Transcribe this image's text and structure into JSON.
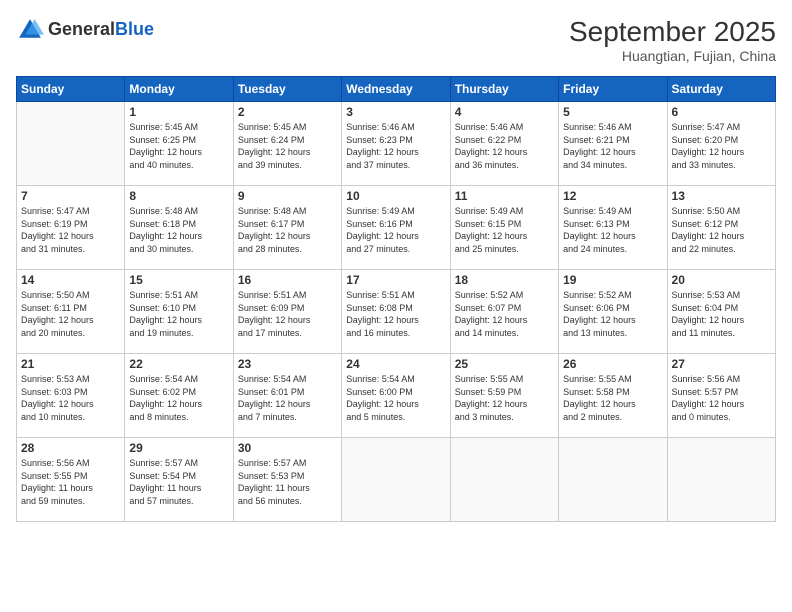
{
  "header": {
    "logo_general": "General",
    "logo_blue": "Blue",
    "month": "September 2025",
    "location": "Huangtian, Fujian, China"
  },
  "days_of_week": [
    "Sunday",
    "Monday",
    "Tuesday",
    "Wednesday",
    "Thursday",
    "Friday",
    "Saturday"
  ],
  "weeks": [
    [
      {
        "day": "",
        "info": ""
      },
      {
        "day": "1",
        "info": "Sunrise: 5:45 AM\nSunset: 6:25 PM\nDaylight: 12 hours\nand 40 minutes."
      },
      {
        "day": "2",
        "info": "Sunrise: 5:45 AM\nSunset: 6:24 PM\nDaylight: 12 hours\nand 39 minutes."
      },
      {
        "day": "3",
        "info": "Sunrise: 5:46 AM\nSunset: 6:23 PM\nDaylight: 12 hours\nand 37 minutes."
      },
      {
        "day": "4",
        "info": "Sunrise: 5:46 AM\nSunset: 6:22 PM\nDaylight: 12 hours\nand 36 minutes."
      },
      {
        "day": "5",
        "info": "Sunrise: 5:46 AM\nSunset: 6:21 PM\nDaylight: 12 hours\nand 34 minutes."
      },
      {
        "day": "6",
        "info": "Sunrise: 5:47 AM\nSunset: 6:20 PM\nDaylight: 12 hours\nand 33 minutes."
      }
    ],
    [
      {
        "day": "7",
        "info": "Sunrise: 5:47 AM\nSunset: 6:19 PM\nDaylight: 12 hours\nand 31 minutes."
      },
      {
        "day": "8",
        "info": "Sunrise: 5:48 AM\nSunset: 6:18 PM\nDaylight: 12 hours\nand 30 minutes."
      },
      {
        "day": "9",
        "info": "Sunrise: 5:48 AM\nSunset: 6:17 PM\nDaylight: 12 hours\nand 28 minutes."
      },
      {
        "day": "10",
        "info": "Sunrise: 5:49 AM\nSunset: 6:16 PM\nDaylight: 12 hours\nand 27 minutes."
      },
      {
        "day": "11",
        "info": "Sunrise: 5:49 AM\nSunset: 6:15 PM\nDaylight: 12 hours\nand 25 minutes."
      },
      {
        "day": "12",
        "info": "Sunrise: 5:49 AM\nSunset: 6:13 PM\nDaylight: 12 hours\nand 24 minutes."
      },
      {
        "day": "13",
        "info": "Sunrise: 5:50 AM\nSunset: 6:12 PM\nDaylight: 12 hours\nand 22 minutes."
      }
    ],
    [
      {
        "day": "14",
        "info": "Sunrise: 5:50 AM\nSunset: 6:11 PM\nDaylight: 12 hours\nand 20 minutes."
      },
      {
        "day": "15",
        "info": "Sunrise: 5:51 AM\nSunset: 6:10 PM\nDaylight: 12 hours\nand 19 minutes."
      },
      {
        "day": "16",
        "info": "Sunrise: 5:51 AM\nSunset: 6:09 PM\nDaylight: 12 hours\nand 17 minutes."
      },
      {
        "day": "17",
        "info": "Sunrise: 5:51 AM\nSunset: 6:08 PM\nDaylight: 12 hours\nand 16 minutes."
      },
      {
        "day": "18",
        "info": "Sunrise: 5:52 AM\nSunset: 6:07 PM\nDaylight: 12 hours\nand 14 minutes."
      },
      {
        "day": "19",
        "info": "Sunrise: 5:52 AM\nSunset: 6:06 PM\nDaylight: 12 hours\nand 13 minutes."
      },
      {
        "day": "20",
        "info": "Sunrise: 5:53 AM\nSunset: 6:04 PM\nDaylight: 12 hours\nand 11 minutes."
      }
    ],
    [
      {
        "day": "21",
        "info": "Sunrise: 5:53 AM\nSunset: 6:03 PM\nDaylight: 12 hours\nand 10 minutes."
      },
      {
        "day": "22",
        "info": "Sunrise: 5:54 AM\nSunset: 6:02 PM\nDaylight: 12 hours\nand 8 minutes."
      },
      {
        "day": "23",
        "info": "Sunrise: 5:54 AM\nSunset: 6:01 PM\nDaylight: 12 hours\nand 7 minutes."
      },
      {
        "day": "24",
        "info": "Sunrise: 5:54 AM\nSunset: 6:00 PM\nDaylight: 12 hours\nand 5 minutes."
      },
      {
        "day": "25",
        "info": "Sunrise: 5:55 AM\nSunset: 5:59 PM\nDaylight: 12 hours\nand 3 minutes."
      },
      {
        "day": "26",
        "info": "Sunrise: 5:55 AM\nSunset: 5:58 PM\nDaylight: 12 hours\nand 2 minutes."
      },
      {
        "day": "27",
        "info": "Sunrise: 5:56 AM\nSunset: 5:57 PM\nDaylight: 12 hours\nand 0 minutes."
      }
    ],
    [
      {
        "day": "28",
        "info": "Sunrise: 5:56 AM\nSunset: 5:55 PM\nDaylight: 11 hours\nand 59 minutes."
      },
      {
        "day": "29",
        "info": "Sunrise: 5:57 AM\nSunset: 5:54 PM\nDaylight: 11 hours\nand 57 minutes."
      },
      {
        "day": "30",
        "info": "Sunrise: 5:57 AM\nSunset: 5:53 PM\nDaylight: 11 hours\nand 56 minutes."
      },
      {
        "day": "",
        "info": ""
      },
      {
        "day": "",
        "info": ""
      },
      {
        "day": "",
        "info": ""
      },
      {
        "day": "",
        "info": ""
      }
    ]
  ]
}
